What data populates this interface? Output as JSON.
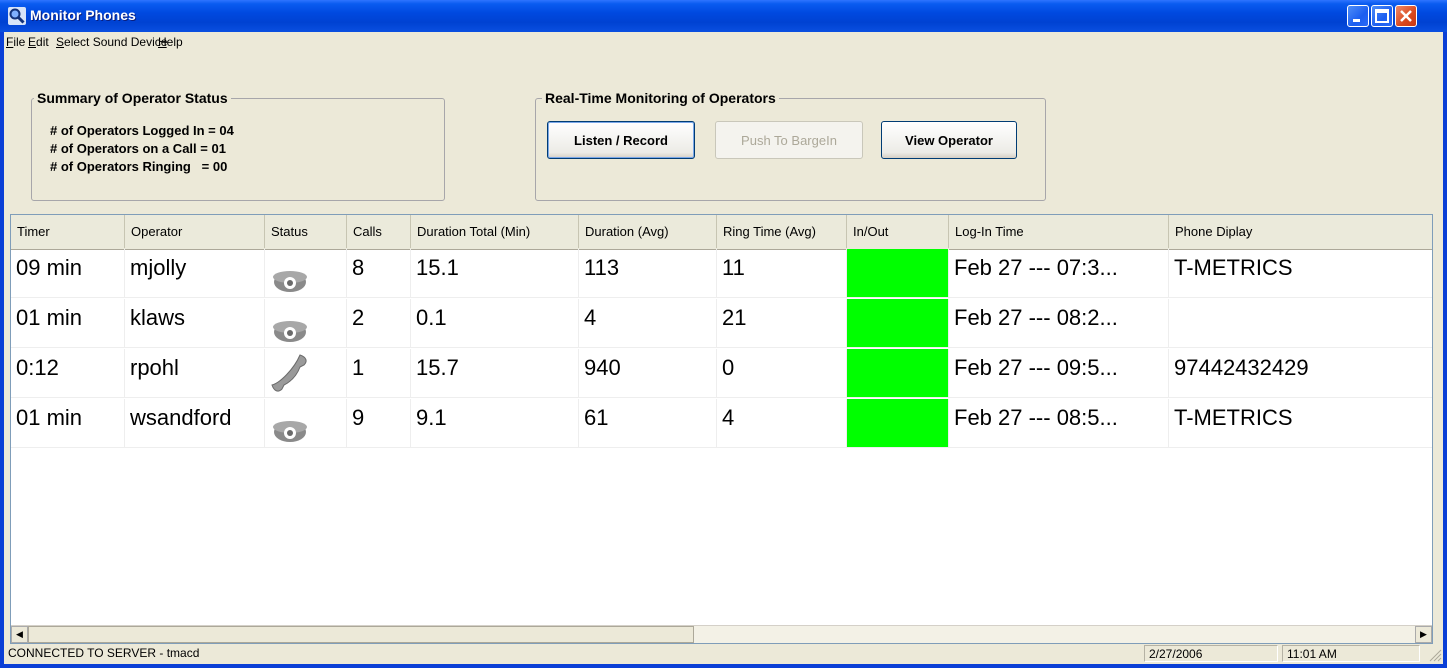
{
  "window": {
    "title": "Monitor Phones"
  },
  "menu": {
    "file": {
      "accel": "F",
      "rest": "ile"
    },
    "edit": {
      "accel": "E",
      "rest": "dit"
    },
    "sound": {
      "accel": "S",
      "rest": "elect Sound Device"
    },
    "help": {
      "accel": "H",
      "rest": "elp"
    }
  },
  "summary": {
    "title": "Summary of Operator Status",
    "lines": [
      "# of Operators Logged In = 04",
      "# of Operators on a Call = 01",
      "# of Operators Ringing   = 00"
    ]
  },
  "monitoring": {
    "title": "Real-Time Monitoring of Operators",
    "listen_label": "Listen / Record",
    "barge_label": "Push To BargeIn",
    "view_label": "View Operator"
  },
  "table": {
    "columns": [
      "Timer",
      "Operator",
      "Status",
      "Calls",
      "Duration Total (Min)",
      "Duration (Avg)",
      "Ring Time (Avg)",
      "In/Out",
      "Log-In Time",
      "Phone Diplay"
    ],
    "rows": [
      {
        "timer": "09 min",
        "operator": "mjolly",
        "status_icon": "phone-idle-icon",
        "calls": "8",
        "dur_total": "15.1",
        "dur_avg": "113",
        "ring_avg": "11",
        "inout_color": "#00ff00",
        "login": "Feb 27 --- 07:3...",
        "phone": "T-METRICS"
      },
      {
        "timer": "01 min",
        "operator": "klaws",
        "status_icon": "phone-idle-icon",
        "calls": "2",
        "dur_total": "0.1",
        "dur_avg": "4",
        "ring_avg": "21",
        "inout_color": "#00ff00",
        "login": "Feb 27 --- 08:2...",
        "phone": ""
      },
      {
        "timer": "0:12",
        "operator": "rpohl",
        "status_icon": "phone-on-call-icon",
        "calls": "1",
        "dur_total": "15.7",
        "dur_avg": "940",
        "ring_avg": "0",
        "inout_color": "#00ff00",
        "login": "Feb 27 --- 09:5...",
        "phone": "97442432429"
      },
      {
        "timer": "01 min",
        "operator": "wsandford",
        "status_icon": "phone-idle-icon",
        "calls": "9",
        "dur_total": "9.1",
        "dur_avg": "61",
        "ring_avg": "4",
        "inout_color": "#00ff00",
        "login": "Feb 27 --- 08:5...",
        "phone": "T-METRICS"
      }
    ]
  },
  "status": {
    "connection": "CONNECTED TO SERVER - tmacd",
    "date": "2/27/2006",
    "time": "11:01 AM"
  }
}
